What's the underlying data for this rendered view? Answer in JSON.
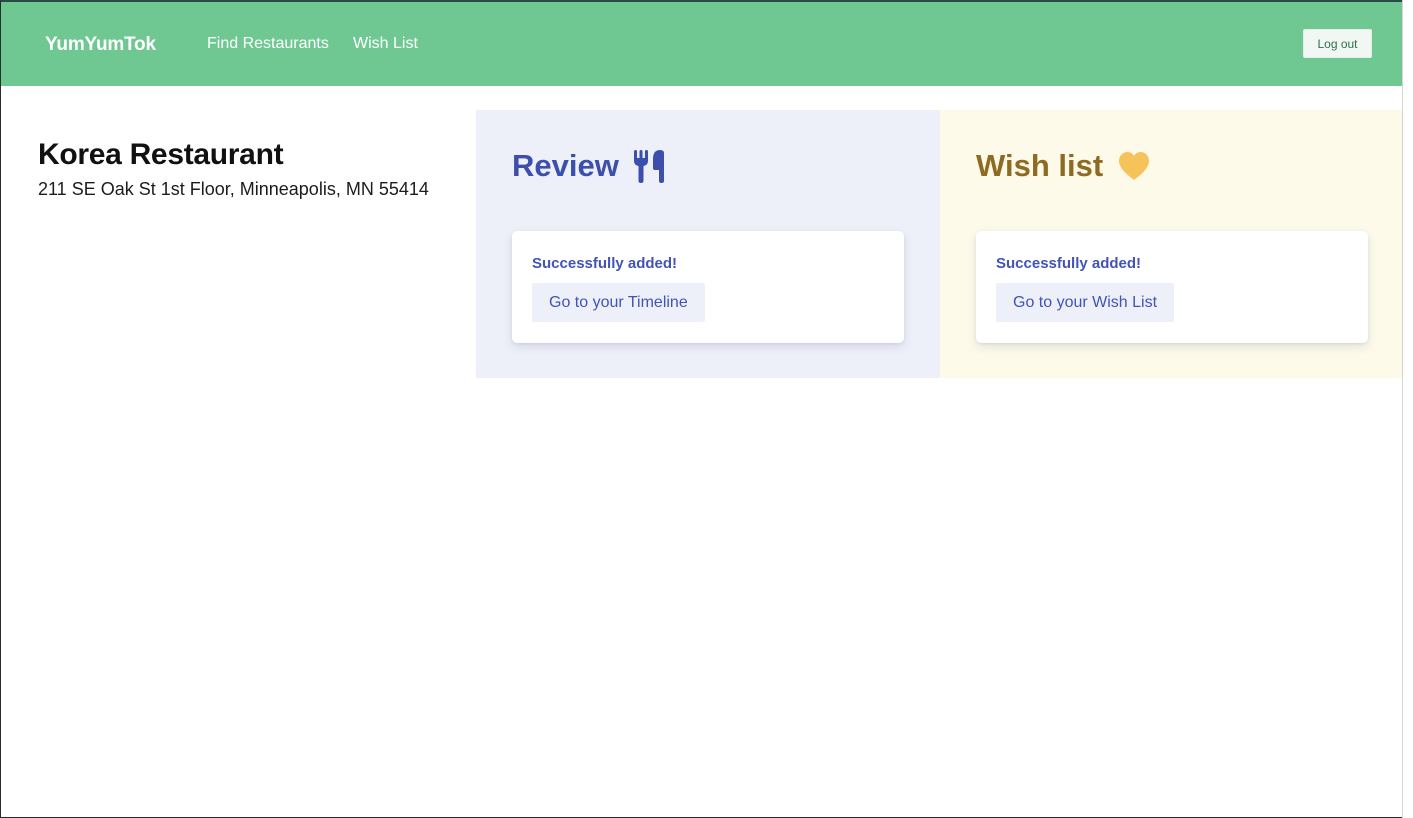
{
  "navbar": {
    "brand": "YumYumTok",
    "links": [
      {
        "label": "Find Restaurants"
      },
      {
        "label": "Wish List"
      }
    ],
    "logout_label": "Log out",
    "background": "#6fc892"
  },
  "restaurant": {
    "name": "Korea Restaurant",
    "address": "211 SE Oak St 1st Floor, Minneapolis, MN 55414"
  },
  "review_panel": {
    "title": "Review",
    "icon": "utensils-icon",
    "color": "#3c4fac",
    "background": "#edf0f9",
    "success_text": "Successfully added!",
    "button_label": "Go to your Timeline"
  },
  "wish_panel": {
    "title": "Wish list",
    "icon": "heart-icon",
    "color": "#8e6b22",
    "icon_color": "#f6c35a",
    "background": "#fdfaea",
    "success_text": "Successfully added!",
    "button_label": "Go to your Wish List"
  }
}
